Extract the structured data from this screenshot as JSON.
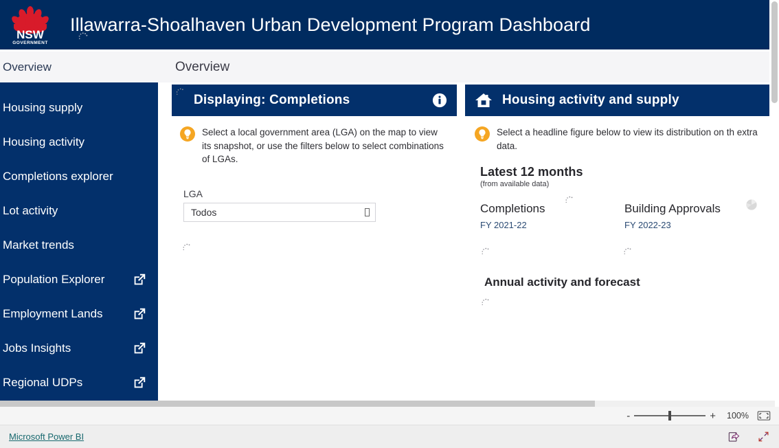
{
  "header": {
    "title": "Illawarra-Shoalhaven Urban Development Program Dashboard",
    "logo_alt": "NSW Government",
    "logo_word": "NSW",
    "logo_sub": "GOVERNMENT"
  },
  "breadcrumb": {
    "sidebar_crumb": "Overview",
    "page_title": "Overview"
  },
  "sidebar": {
    "items": [
      {
        "label": "Housing supply",
        "external": false
      },
      {
        "label": "Housing activity",
        "external": false
      },
      {
        "label": "Completions explorer",
        "external": false
      },
      {
        "label": "Lot activity",
        "external": false
      },
      {
        "label": "Market trends",
        "external": false
      },
      {
        "label": "Population Explorer",
        "external": true
      },
      {
        "label": "Employment Lands",
        "external": true
      },
      {
        "label": "Jobs Insights",
        "external": true
      },
      {
        "label": "Regional UDPs",
        "external": true
      }
    ]
  },
  "center_card": {
    "title": "Displaying: Completions",
    "info_icon": "info-icon",
    "tip_icon": "lightbulb-icon",
    "tip_text": "Select a local government area (LGA) on the map to view its snapshot, or use the filters below to select combinations of LGAs.",
    "filter_label": "LGA",
    "filter_value": "Todos",
    "filter_placeholder": "Todos"
  },
  "right_card": {
    "title": "Housing activity and supply",
    "home_icon": "home-icon",
    "tip_icon": "lightbulb-icon",
    "tip_text": "Select a headline figure below to view its distribution on th extra data.",
    "section_title": "Latest 12 months",
    "section_sub": "(from available data)",
    "metrics": [
      {
        "name": "Completions",
        "fy": "FY 2021-22",
        "badge": "loading-spinner"
      },
      {
        "name": "Building Approvals",
        "fy": "FY 2022-23",
        "badge": "loading-circle-icon"
      }
    ],
    "forecast_title": "Annual activity and forecast"
  },
  "zoombar": {
    "minus": "-",
    "plus": "+",
    "percent": "100%",
    "fit_icon": "fit-to-page-icon"
  },
  "footer": {
    "link": "Microsoft Power BI",
    "share_icon": "share-icon",
    "fullscreen_icon": "fullscreen-icon"
  },
  "colors": {
    "navy": "#002b5f",
    "sidebar_navy": "#03306b",
    "accent_orange": "#f5a623",
    "logo_red": "#d81b2a",
    "link_teal": "#17686e",
    "page_bg": "#f5f5f7"
  }
}
